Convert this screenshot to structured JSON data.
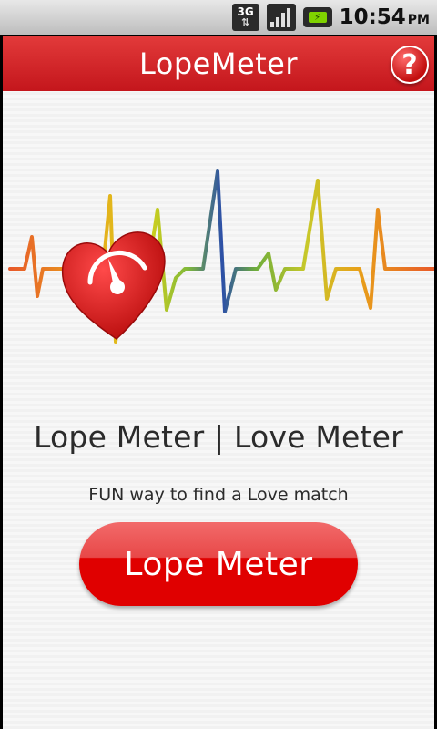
{
  "status_bar": {
    "network": "3G",
    "time": "10:54",
    "ampm": "PM",
    "icons": [
      "3g-icon",
      "signal-icon",
      "battery-charging-icon"
    ]
  },
  "app": {
    "title": "LopeMeter",
    "help_label": "?",
    "headline": "Lope Meter | Love Meter",
    "tagline": "FUN way to find a Love match",
    "button_label": "Lope Meter"
  },
  "colors": {
    "title_bar": "#d42020",
    "button": "#e00000",
    "heart": "#d01818",
    "text": "#2b2b2b"
  }
}
